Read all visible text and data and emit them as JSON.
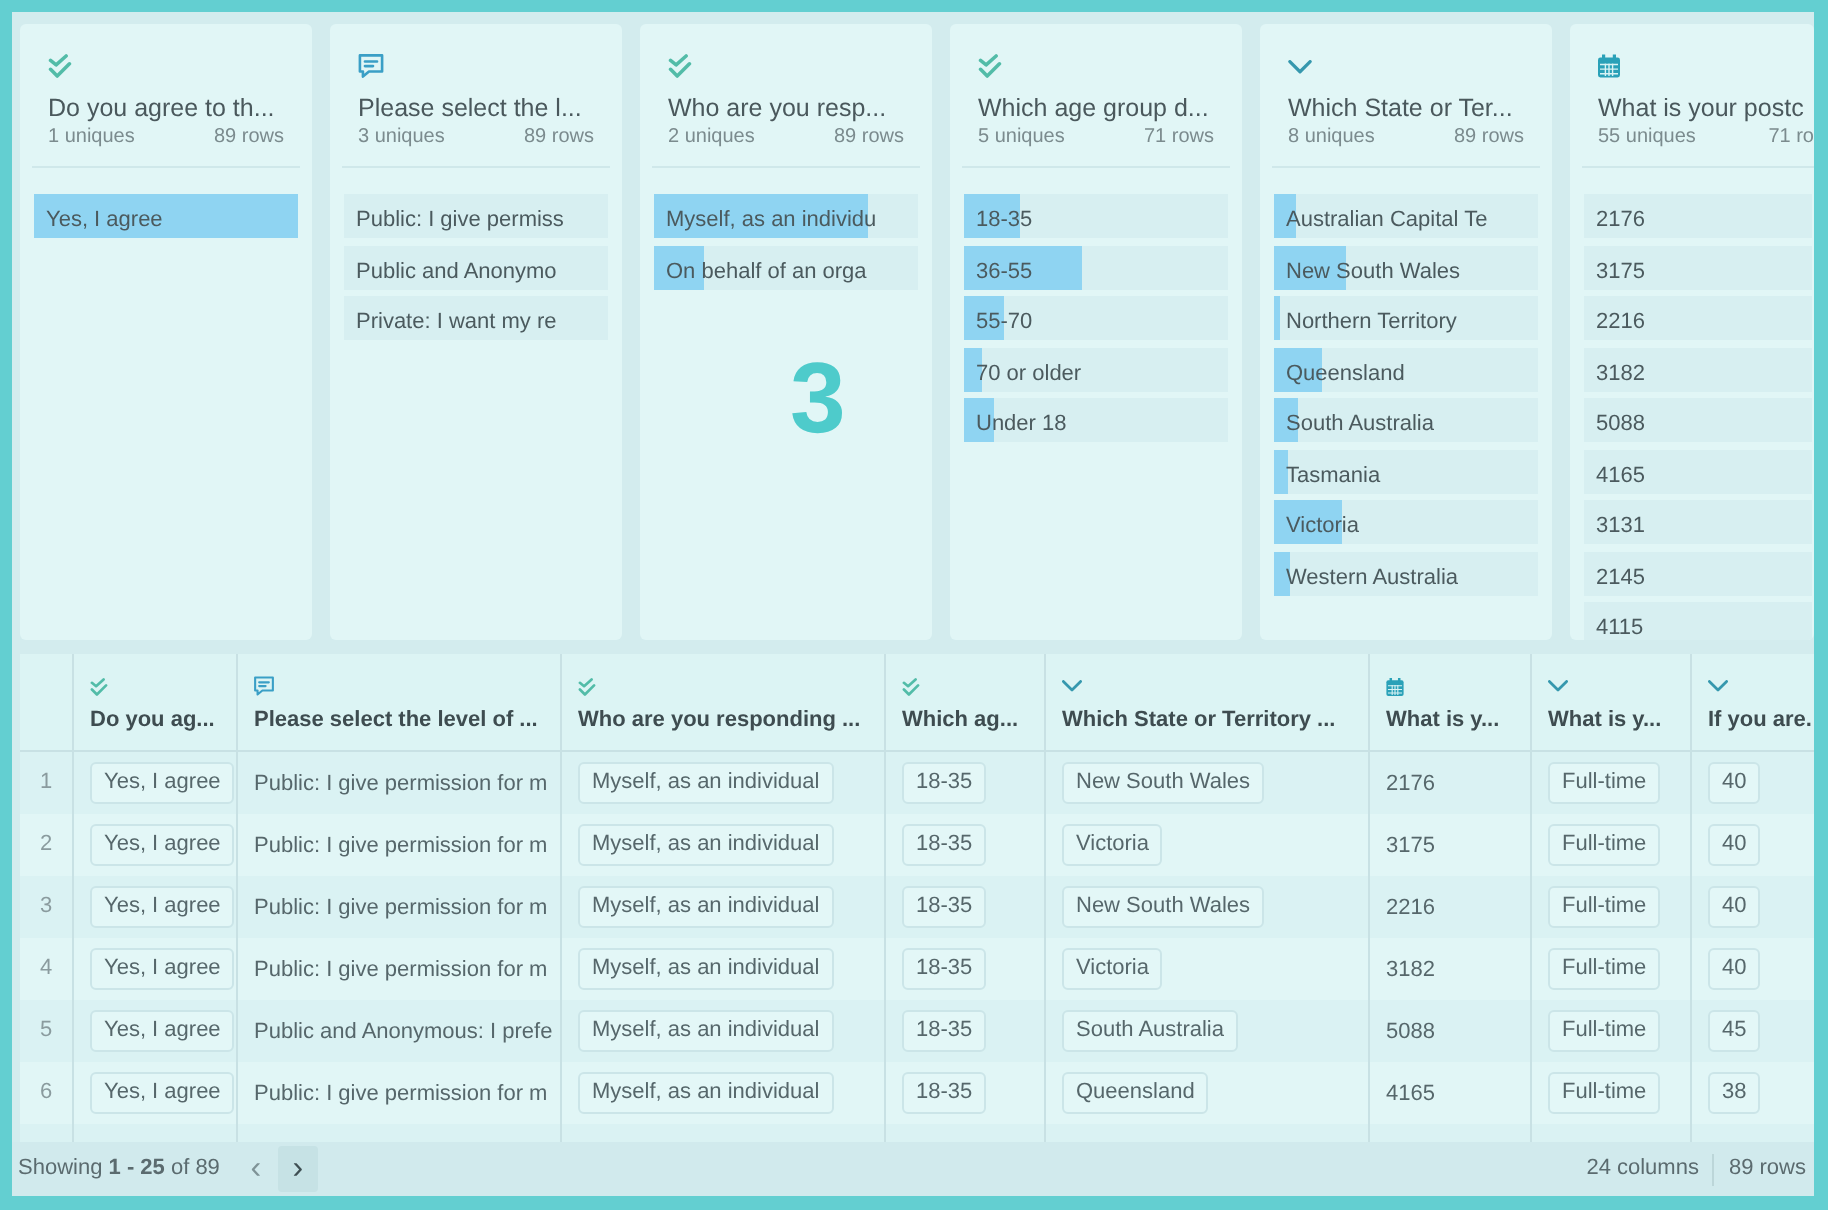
{
  "overlay_number": "3",
  "summary_cards": [
    {
      "kind": "checkbox",
      "title": "Do you agree to th...",
      "uniques": "1 uniques",
      "rows": "89 rows",
      "values": [
        {
          "label": "Yes, I agree",
          "level": 1
        }
      ]
    },
    {
      "kind": "comment",
      "title": "Please select the l...",
      "uniques": "3 uniques",
      "rows": "89 rows",
      "values": [
        {
          "label": "Public: I give permiss"
        },
        {
          "label": "Public and Anonymo"
        },
        {
          "label": "Private: I want my re"
        }
      ]
    },
    {
      "kind": "checkbox",
      "title": "Who are you resp...",
      "uniques": "2 uniques",
      "rows": "89 rows",
      "values": [
        {
          "label": "Myself, as an individu",
          "level": 0.81
        },
        {
          "label": "On behalf of an orga",
          "level": 0.19
        }
      ]
    },
    {
      "kind": "checkbox",
      "title": "Which age group d...",
      "uniques": "5 uniques",
      "rows": "71 rows",
      "values": [
        {
          "label": "18-35",
          "level": 0.21
        },
        {
          "label": "36-55",
          "level": 0.45
        },
        {
          "label": "55-70",
          "level": 0.15
        },
        {
          "label": "70 or older",
          "level": 0.07
        },
        {
          "label": "Under 18",
          "level": 0.11
        }
      ]
    },
    {
      "kind": "dropdown",
      "title": "Which State or Ter...",
      "uniques": "8 uniques",
      "rows": "89 rows",
      "values": [
        {
          "label": "Australian Capital Te",
          "level": 0.08
        },
        {
          "label": "New South Wales",
          "level": 0.27
        },
        {
          "label": "Northern Territory",
          "level": 0.02
        },
        {
          "label": "Queensland",
          "level": 0.18
        },
        {
          "label": "South Australia",
          "level": 0.09
        },
        {
          "label": "Tasmania",
          "level": 0.05
        },
        {
          "label": "Victoria",
          "level": 0.26
        },
        {
          "label": "Western Australia",
          "level": 0.06
        }
      ]
    },
    {
      "kind": "date",
      "title": "What is your postc",
      "uniques": "55 uniques",
      "rows": "71 ro",
      "values": [
        {
          "label": "2176"
        },
        {
          "label": "3175"
        },
        {
          "label": "2216"
        },
        {
          "label": "3182"
        },
        {
          "label": "5088"
        },
        {
          "label": "4165"
        },
        {
          "label": "3131"
        },
        {
          "label": "2145"
        },
        {
          "label": "4115"
        }
      ]
    }
  ],
  "table": {
    "columns": [
      {
        "kind": "checkbox",
        "label": "Do you ag..."
      },
      {
        "kind": "comment",
        "label": "Please select the level of ..."
      },
      {
        "kind": "checkbox",
        "label": "Who are you responding ..."
      },
      {
        "kind": "checkbox",
        "label": "Which ag..."
      },
      {
        "kind": "dropdown",
        "label": "Which State or Territory ..."
      },
      {
        "kind": "date",
        "label": "What is y..."
      },
      {
        "kind": "dropdown",
        "label": "What is y..."
      },
      {
        "kind": "dropdown",
        "label": "If you are."
      }
    ],
    "rows": [
      {
        "number": "1",
        "cells": [
          "Yes, I agree",
          "Public: I give permission for m",
          "Myself, as an individual",
          "18-35",
          "New South Wales",
          "2176",
          "Full-time",
          "40"
        ]
      },
      {
        "number": "2",
        "cells": [
          "Yes, I agree",
          "Public: I give permission for m",
          "Myself, as an individual",
          "18-35",
          "Victoria",
          "3175",
          "Full-time",
          "40"
        ]
      },
      {
        "number": "3",
        "cells": [
          "Yes, I agree",
          "Public: I give permission for m",
          "Myself, as an individual",
          "18-35",
          "New South Wales",
          "2216",
          "Full-time",
          "40"
        ]
      },
      {
        "number": "4",
        "cells": [
          "Yes, I agree",
          "Public: I give permission for m",
          "Myself, as an individual",
          "18-35",
          "Victoria",
          "3182",
          "Full-time",
          "40"
        ]
      },
      {
        "number": "5",
        "cells": [
          "Yes, I agree",
          "Public and Anonymous: I prefe",
          "Myself, as an individual",
          "18-35",
          "South Australia",
          "5088",
          "Full-time",
          "45"
        ]
      },
      {
        "number": "6",
        "cells": [
          "Yes, I agree",
          "Public: I give permission for m",
          "Myself, as an individual",
          "18-35",
          "Queensland",
          "4165",
          "Full-time",
          "38"
        ]
      }
    ]
  },
  "footer": {
    "showing": "Showing **1 - 25** of 89",
    "prev": {
      "label": "‹",
      "disabled": true
    },
    "next": {
      "label": "›",
      "disabled": false
    },
    "column_count": "24 columns",
    "row_count": "89 rows"
  }
}
